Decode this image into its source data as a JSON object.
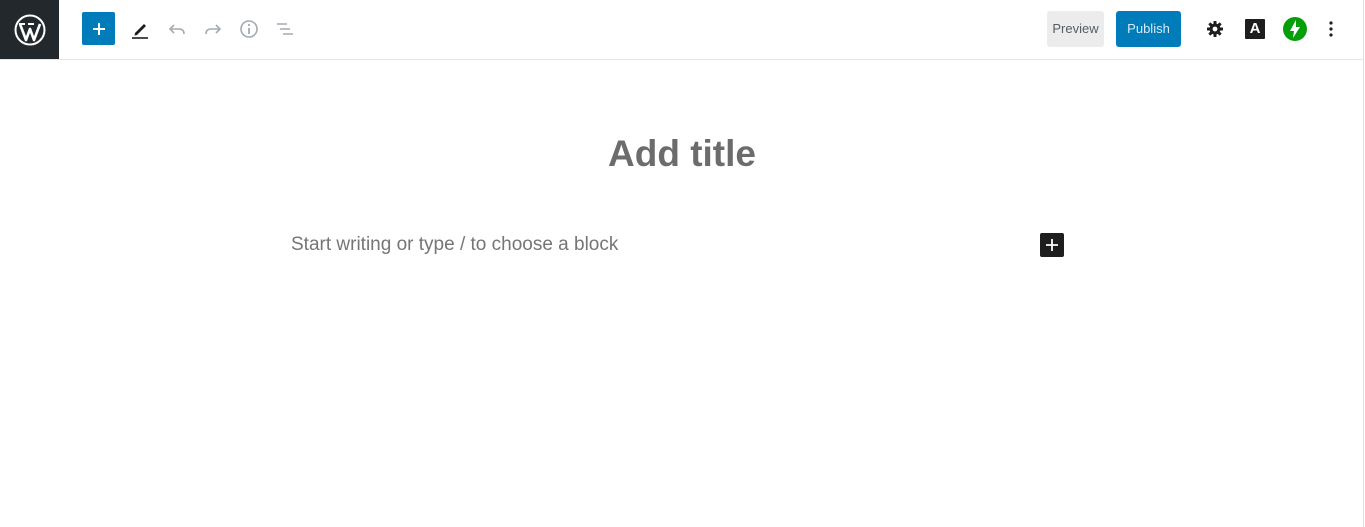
{
  "header": {
    "preview_label": "Preview",
    "publish_label": "Publish",
    "font_button_letter": "A"
  },
  "icons": {
    "logo": "wordpress-logo",
    "add_block": "plus-icon",
    "tools": "pencil-icon",
    "undo": "undo-icon",
    "redo": "redo-icon",
    "info": "info-icon",
    "outline": "list-view-icon",
    "settings": "gear-icon",
    "font": "letter-a-icon",
    "jetpack": "jetpack-bolt-icon",
    "more": "vertical-ellipsis-icon"
  },
  "editor": {
    "title_placeholder": "Add title",
    "body_placeholder": "Start writing or type / to choose a block"
  },
  "colors": {
    "accent": "#007cba",
    "logo_bg": "#23282d",
    "jetpack": "#069e08"
  }
}
